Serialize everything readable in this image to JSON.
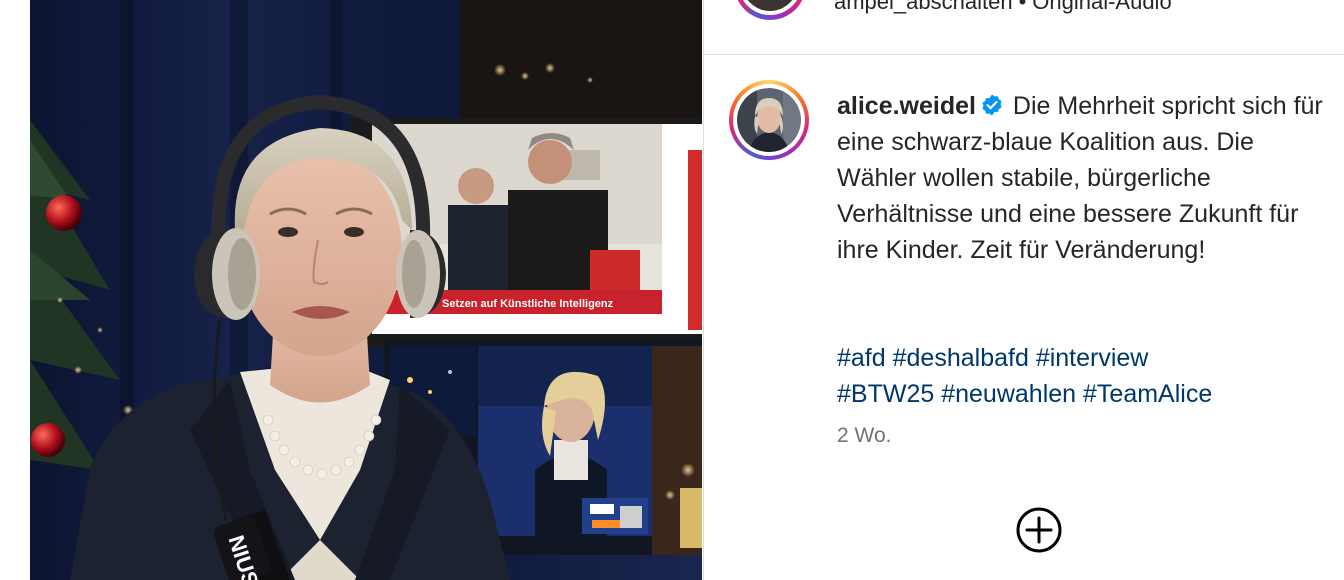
{
  "post_header": {
    "audio_user": "ampel_abschalten",
    "separator": "•",
    "audio_label": "Original-Audio"
  },
  "caption": {
    "username": "alice.weidel",
    "verified": true,
    "text": "Die Mehrheit spricht sich für eine schwarz-blaue Koalition aus. Die Wähler wollen stabile, bürgerliche Verhältnisse und eine bessere Zukunft für ihre Kinder. Zeit für Veränderung!",
    "hashtags": [
      "#afd",
      "#deshalbafd",
      "#interview",
      "#BTW25",
      "#neuwahlen",
      "#TeamAlice"
    ],
    "time": "2 Wo."
  },
  "video": {
    "tv_ticker_text": "Setzen auf Künstliche Intelligenz",
    "mic_label": "NIUS"
  },
  "icons": {
    "verified": "verified-badge-icon",
    "add": "add-circle-icon"
  },
  "colors": {
    "link": "#00376b",
    "verified": "#0095f6",
    "muted": "#737373"
  }
}
